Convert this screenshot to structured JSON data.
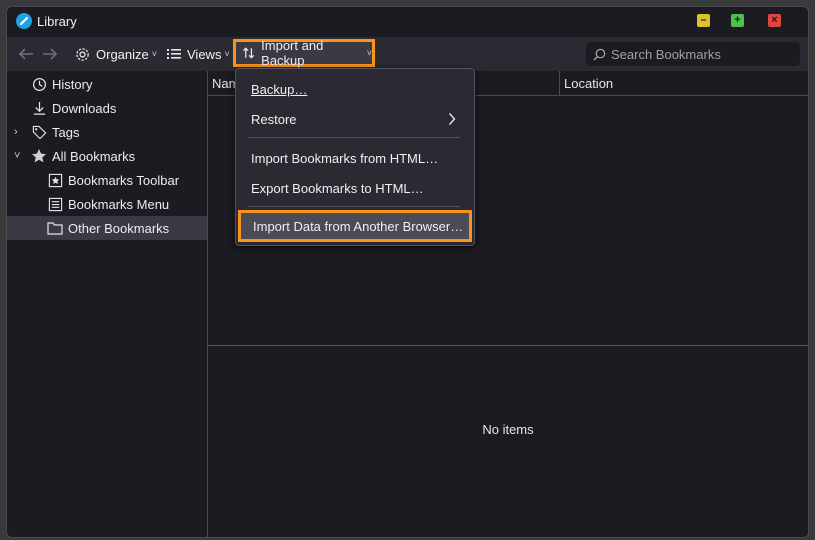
{
  "window": {
    "title": "Library"
  },
  "toolbar": {
    "organize_label": "Organize",
    "views_label": "Views",
    "import_backup_label": "Import and Backup",
    "search_placeholder": "Search Bookmarks"
  },
  "sidebar": {
    "items": [
      {
        "label": "History",
        "icon": "history-icon"
      },
      {
        "label": "Downloads",
        "icon": "download-icon"
      },
      {
        "label": "Tags",
        "icon": "tag-icon"
      },
      {
        "label": "All Bookmarks",
        "icon": "star-icon"
      },
      {
        "label": "Bookmarks Toolbar",
        "icon": "bookmarks-toolbar-icon"
      },
      {
        "label": "Bookmarks Menu",
        "icon": "bookmarks-menu-icon"
      },
      {
        "label": "Other Bookmarks",
        "icon": "folder-icon"
      }
    ]
  },
  "list": {
    "columns": [
      "Nam",
      "Location"
    ],
    "empty_text": "No items"
  },
  "menu": {
    "items": [
      "Backup…",
      "Restore",
      "Import Bookmarks from HTML…",
      "Export Bookmarks to HTML…",
      "Import Data from Another Browser…"
    ]
  },
  "colors": {
    "highlight": "#f7941d",
    "background": "#1c1b22",
    "toolbar": "#2b2a33"
  }
}
